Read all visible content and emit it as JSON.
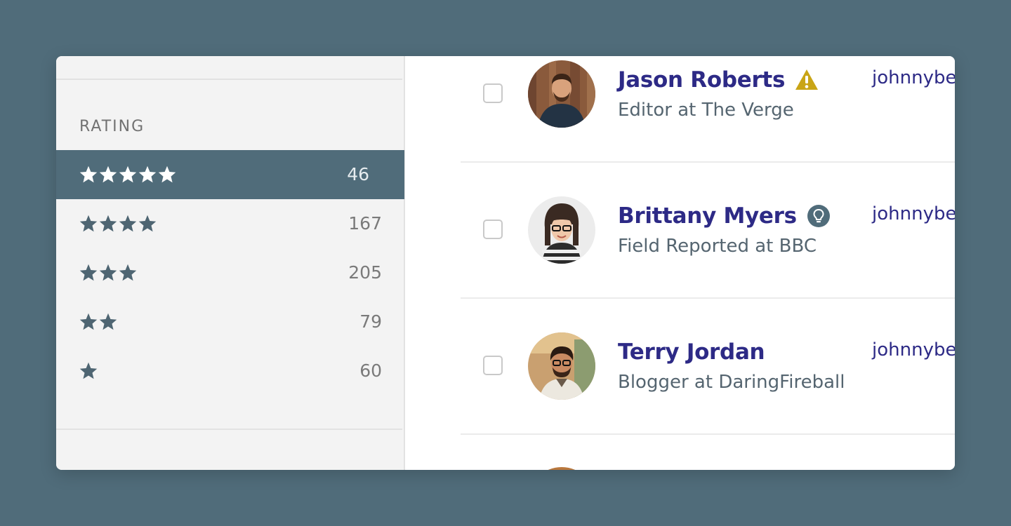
{
  "sidebar": {
    "section_label": "RATING",
    "ratings": [
      {
        "stars": 5,
        "count": "46",
        "selected": true
      },
      {
        "stars": 4,
        "count": "167",
        "selected": false
      },
      {
        "stars": 3,
        "count": "205",
        "selected": false
      },
      {
        "stars": 2,
        "count": "79",
        "selected": false
      },
      {
        "stars": 1,
        "count": "60",
        "selected": false
      }
    ]
  },
  "contacts": [
    {
      "name": "Jason Roberts",
      "title": "Editor at The Verge",
      "handle": "johnnybe",
      "badge": "warning-icon",
      "checked": false
    },
    {
      "name": "Brittany Myers",
      "title": "Field Reported at BBC",
      "handle": "johnnybe",
      "badge": "lightbulb-icon",
      "checked": false
    },
    {
      "name": "Terry Jordan",
      "title": "Blogger at DaringFireball",
      "handle": "johnnybe",
      "badge": "",
      "checked": false
    }
  ],
  "colors": {
    "background": "#506c7a",
    "selected_row": "#506c7a",
    "name_text": "#2d2a86",
    "warning": "#c9a516",
    "bulb_badge": "#506c7a"
  }
}
